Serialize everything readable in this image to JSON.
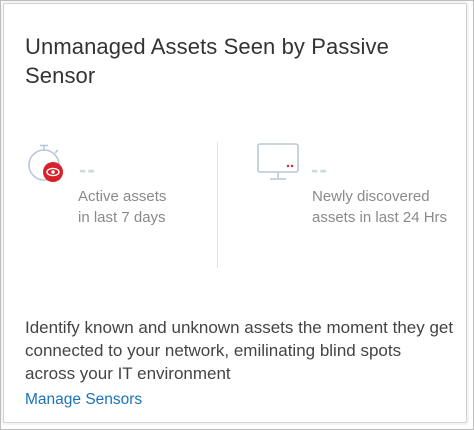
{
  "card": {
    "title": "Unmanaged Assets Seen by Passive Sensor",
    "metrics": [
      {
        "icon": "stopwatch-eye-icon",
        "value": "--",
        "label": "Active assets\nin last 7 days"
      },
      {
        "icon": "monitor-icon",
        "value": "--",
        "label": "Newly discovered\nassets in last 24 Hrs"
      }
    ],
    "description": "Identify known and unknown assets the moment they get connected to your network, emilinating blind spots across your IT environment",
    "link_label": "Manage Sensors"
  },
  "colors": {
    "accent_red": "#d8212a",
    "icon_line": "#b7c9d9",
    "link": "#1a73b8"
  }
}
